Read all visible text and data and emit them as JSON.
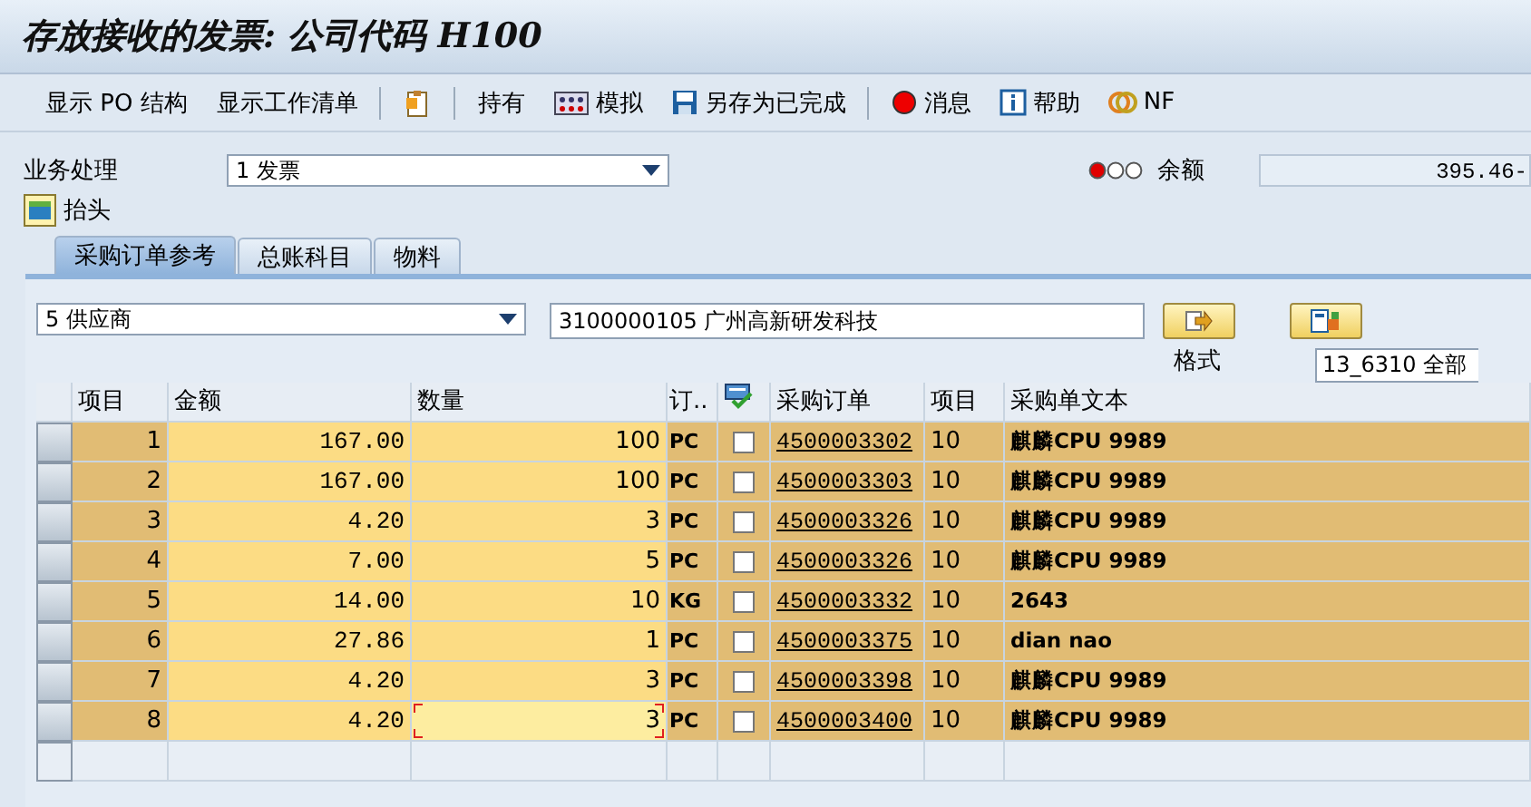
{
  "window": {
    "title": "存放接收的发票: 公司代码 H100"
  },
  "toolbar": [
    {
      "kind": "text",
      "label": "显示 PO 结构"
    },
    {
      "kind": "text",
      "label": "显示工作清单"
    },
    {
      "kind": "sep"
    },
    {
      "kind": "clipboard"
    },
    {
      "kind": "sep"
    },
    {
      "kind": "text",
      "label": "持有"
    },
    {
      "kind": "simulate",
      "label": "模拟"
    },
    {
      "kind": "save",
      "label": "另存为已完成"
    },
    {
      "kind": "sep"
    },
    {
      "kind": "message",
      "label": "消息"
    },
    {
      "kind": "info",
      "label": "帮助"
    },
    {
      "kind": "nf",
      "label": "NF"
    }
  ],
  "header": {
    "transaction_label": "业务处理",
    "transaction_value": "1 发票",
    "balance_lights": [
      {
        "on": true
      },
      {
        "on": false
      },
      {
        "on": false
      }
    ],
    "balance_label": "余额",
    "balance_value": "395.46-",
    "header_button": "抬头"
  },
  "tabs": [
    {
      "label": "采购订单参考",
      "selected": true
    },
    {
      "label": "总账科目",
      "selected": false
    },
    {
      "label": "物料",
      "selected": false
    }
  ],
  "reference": {
    "type_value": "5 供应商",
    "vendor_value": "3100000105 广州高新研发科技",
    "layout_label": "格式",
    "layout_value": "13_6310 全部"
  },
  "table": {
    "columns": [
      "项目",
      "金额",
      "数量",
      "订..",
      "",
      "采购订单",
      "项目",
      "采购单文本"
    ],
    "rows": [
      {
        "item": "1",
        "amount": "167.00",
        "qty": "100",
        "unit": "PC",
        "checked": false,
        "po": "4500003302",
        "po_item": "10",
        "text": "麒麟CPU 9989",
        "current": false
      },
      {
        "item": "2",
        "amount": "167.00",
        "qty": "100",
        "unit": "PC",
        "checked": false,
        "po": "4500003303",
        "po_item": "10",
        "text": "麒麟CPU 9989",
        "current": false
      },
      {
        "item": "3",
        "amount": "4.20",
        "qty": "3",
        "unit": "PC",
        "checked": false,
        "po": "4500003326",
        "po_item": "10",
        "text": "麒麟CPU 9989",
        "current": false
      },
      {
        "item": "4",
        "amount": "7.00",
        "qty": "5",
        "unit": "PC",
        "checked": false,
        "po": "4500003326",
        "po_item": "10",
        "text": "麒麟CPU 9989",
        "current": false
      },
      {
        "item": "5",
        "amount": "14.00",
        "qty": "10",
        "unit": "KG",
        "checked": false,
        "po": "4500003332",
        "po_item": "10",
        "text": "2643",
        "current": false
      },
      {
        "item": "6",
        "amount": "27.86",
        "qty": "1",
        "unit": "PC",
        "checked": false,
        "po": "4500003375",
        "po_item": "10",
        "text": "dian nao",
        "current": false
      },
      {
        "item": "7",
        "amount": "4.20",
        "qty": "3",
        "unit": "PC",
        "checked": false,
        "po": "4500003398",
        "po_item": "10",
        "text": "麒麟CPU 9989",
        "current": false
      },
      {
        "item": "8",
        "amount": "4.20",
        "qty": "3",
        "unit": "PC",
        "checked": false,
        "po": "4500003400",
        "po_item": "10",
        "text": "麒麟CPU 9989",
        "current": true
      }
    ]
  }
}
